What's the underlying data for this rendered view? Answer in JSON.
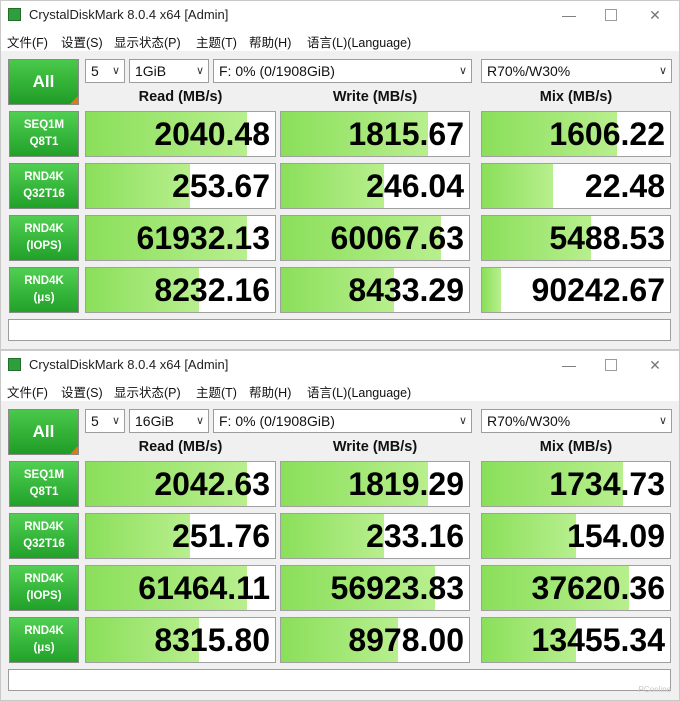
{
  "windows": [
    {
      "title": "CrystalDiskMark 8.0.4 x64 [Admin]",
      "menu": [
        "文件(F)",
        "设置(S)",
        "显示状态(P)",
        "主题(T)",
        "帮助(H)",
        "语言(L)(Language)"
      ],
      "all_label": "All",
      "count": "5",
      "size": "1GiB",
      "drive": "F: 0% (0/1908GiB)",
      "mix_mode": "R70%/W30%",
      "headers": {
        "read": "Read (MB/s)",
        "write": "Write (MB/s)",
        "mix": "Mix (MB/s)"
      },
      "rows": [
        {
          "l1": "SEQ1M",
          "l2": "Q8T1",
          "read": "2040.48",
          "write": "1815.67",
          "mix": "1606.22"
        },
        {
          "l1": "RND4K",
          "l2": "Q32T16",
          "read": "253.67",
          "write": "246.04",
          "mix": "22.48"
        },
        {
          "l1": "RND4K",
          "l2": "(IOPS)",
          "read": "61932.13",
          "write": "60067.63",
          "mix": "5488.53"
        },
        {
          "l1": "RND4K",
          "l2": "(μs)",
          "read": "8232.16",
          "write": "8433.29",
          "mix": "90242.67"
        }
      ],
      "bar_fractions": [
        [
          0.85,
          0.78,
          0.72
        ],
        [
          0.55,
          0.55,
          0.38
        ],
        [
          0.85,
          0.85,
          0.58
        ],
        [
          0.6,
          0.6,
          0.1
        ]
      ]
    },
    {
      "title": "CrystalDiskMark 8.0.4 x64 [Admin]",
      "menu": [
        "文件(F)",
        "设置(S)",
        "显示状态(P)",
        "主题(T)",
        "帮助(H)",
        "语言(L)(Language)"
      ],
      "all_label": "All",
      "count": "5",
      "size": "16GiB",
      "drive": "F: 0% (0/1908GiB)",
      "mix_mode": "R70%/W30%",
      "headers": {
        "read": "Read (MB/s)",
        "write": "Write (MB/s)",
        "mix": "Mix (MB/s)"
      },
      "rows": [
        {
          "l1": "SEQ1M",
          "l2": "Q8T1",
          "read": "2042.63",
          "write": "1819.29",
          "mix": "1734.73"
        },
        {
          "l1": "RND4K",
          "l2": "Q32T16",
          "read": "251.76",
          "write": "233.16",
          "mix": "154.09"
        },
        {
          "l1": "RND4K",
          "l2": "(IOPS)",
          "read": "61464.11",
          "write": "56923.83",
          "mix": "37620.36"
        },
        {
          "l1": "RND4K",
          "l2": "(μs)",
          "read": "8315.80",
          "write": "8978.00",
          "mix": "13455.34"
        }
      ],
      "bar_fractions": [
        [
          0.85,
          0.78,
          0.75
        ],
        [
          0.55,
          0.55,
          0.5
        ],
        [
          0.85,
          0.82,
          0.78
        ],
        [
          0.6,
          0.62,
          0.5
        ]
      ]
    }
  ],
  "watermark": "PConline",
  "colors": {
    "green": "#22a12a",
    "bar": "#8adf5a",
    "accent": "#e07a10"
  }
}
